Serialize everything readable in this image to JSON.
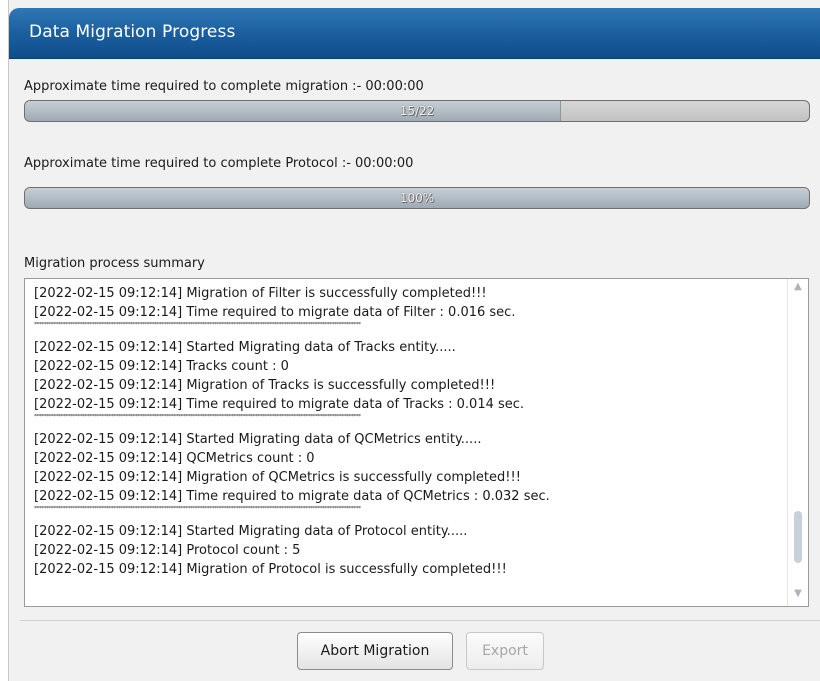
{
  "dialog": {
    "title": "Data Migration Progress"
  },
  "migration": {
    "label": "Approximate time required to complete migration :- 00:00:00",
    "progress_text": "15/22",
    "progress_value": 15,
    "progress_max": 22
  },
  "protocol": {
    "label": "Approximate time required to complete Protocol :- 00:00:00",
    "progress_text": "100%",
    "progress_percent": 100
  },
  "summary": {
    "label": "Migration process summary",
    "separator": "****************************************************************************************************************************************",
    "log_blocks": [
      {
        "lines": [
          "[2022-02-15 09:12:14] Migration of Filter is successfully completed!!!",
          "[2022-02-15 09:12:14] Time required to migrate data of Filter : 0.016 sec."
        ],
        "separator_after": true
      },
      {
        "lines": [
          "[2022-02-15 09:12:14] Started Migrating data of Tracks entity.....",
          "[2022-02-15 09:12:14] Tracks count : 0",
          "[2022-02-15 09:12:14] Migration of Tracks is successfully completed!!!",
          "[2022-02-15 09:12:14] Time required to migrate data of Tracks : 0.014 sec."
        ],
        "separator_after": true
      },
      {
        "lines": [
          "[2022-02-15 09:12:14] Started Migrating data of QCMetrics entity.....",
          "[2022-02-15 09:12:14] QCMetrics count : 0",
          "[2022-02-15 09:12:14] Migration of QCMetrics is successfully completed!!!",
          "[2022-02-15 09:12:14] Time required to migrate data of QCMetrics : 0.032 sec."
        ],
        "separator_after": true
      },
      {
        "lines": [
          "[2022-02-15 09:12:14] Started Migrating data of Protocol entity.....",
          "[2022-02-15 09:12:14] Protocol count : 5",
          "[2022-02-15 09:12:14] Migration of Protocol is successfully completed!!!"
        ],
        "separator_after": false
      }
    ]
  },
  "buttons": {
    "abort_label": "Abort Migration",
    "export_label": "Export"
  },
  "icons": {
    "scroll_up": "chevron-up-icon",
    "scroll_down": "chevron-down-icon"
  }
}
